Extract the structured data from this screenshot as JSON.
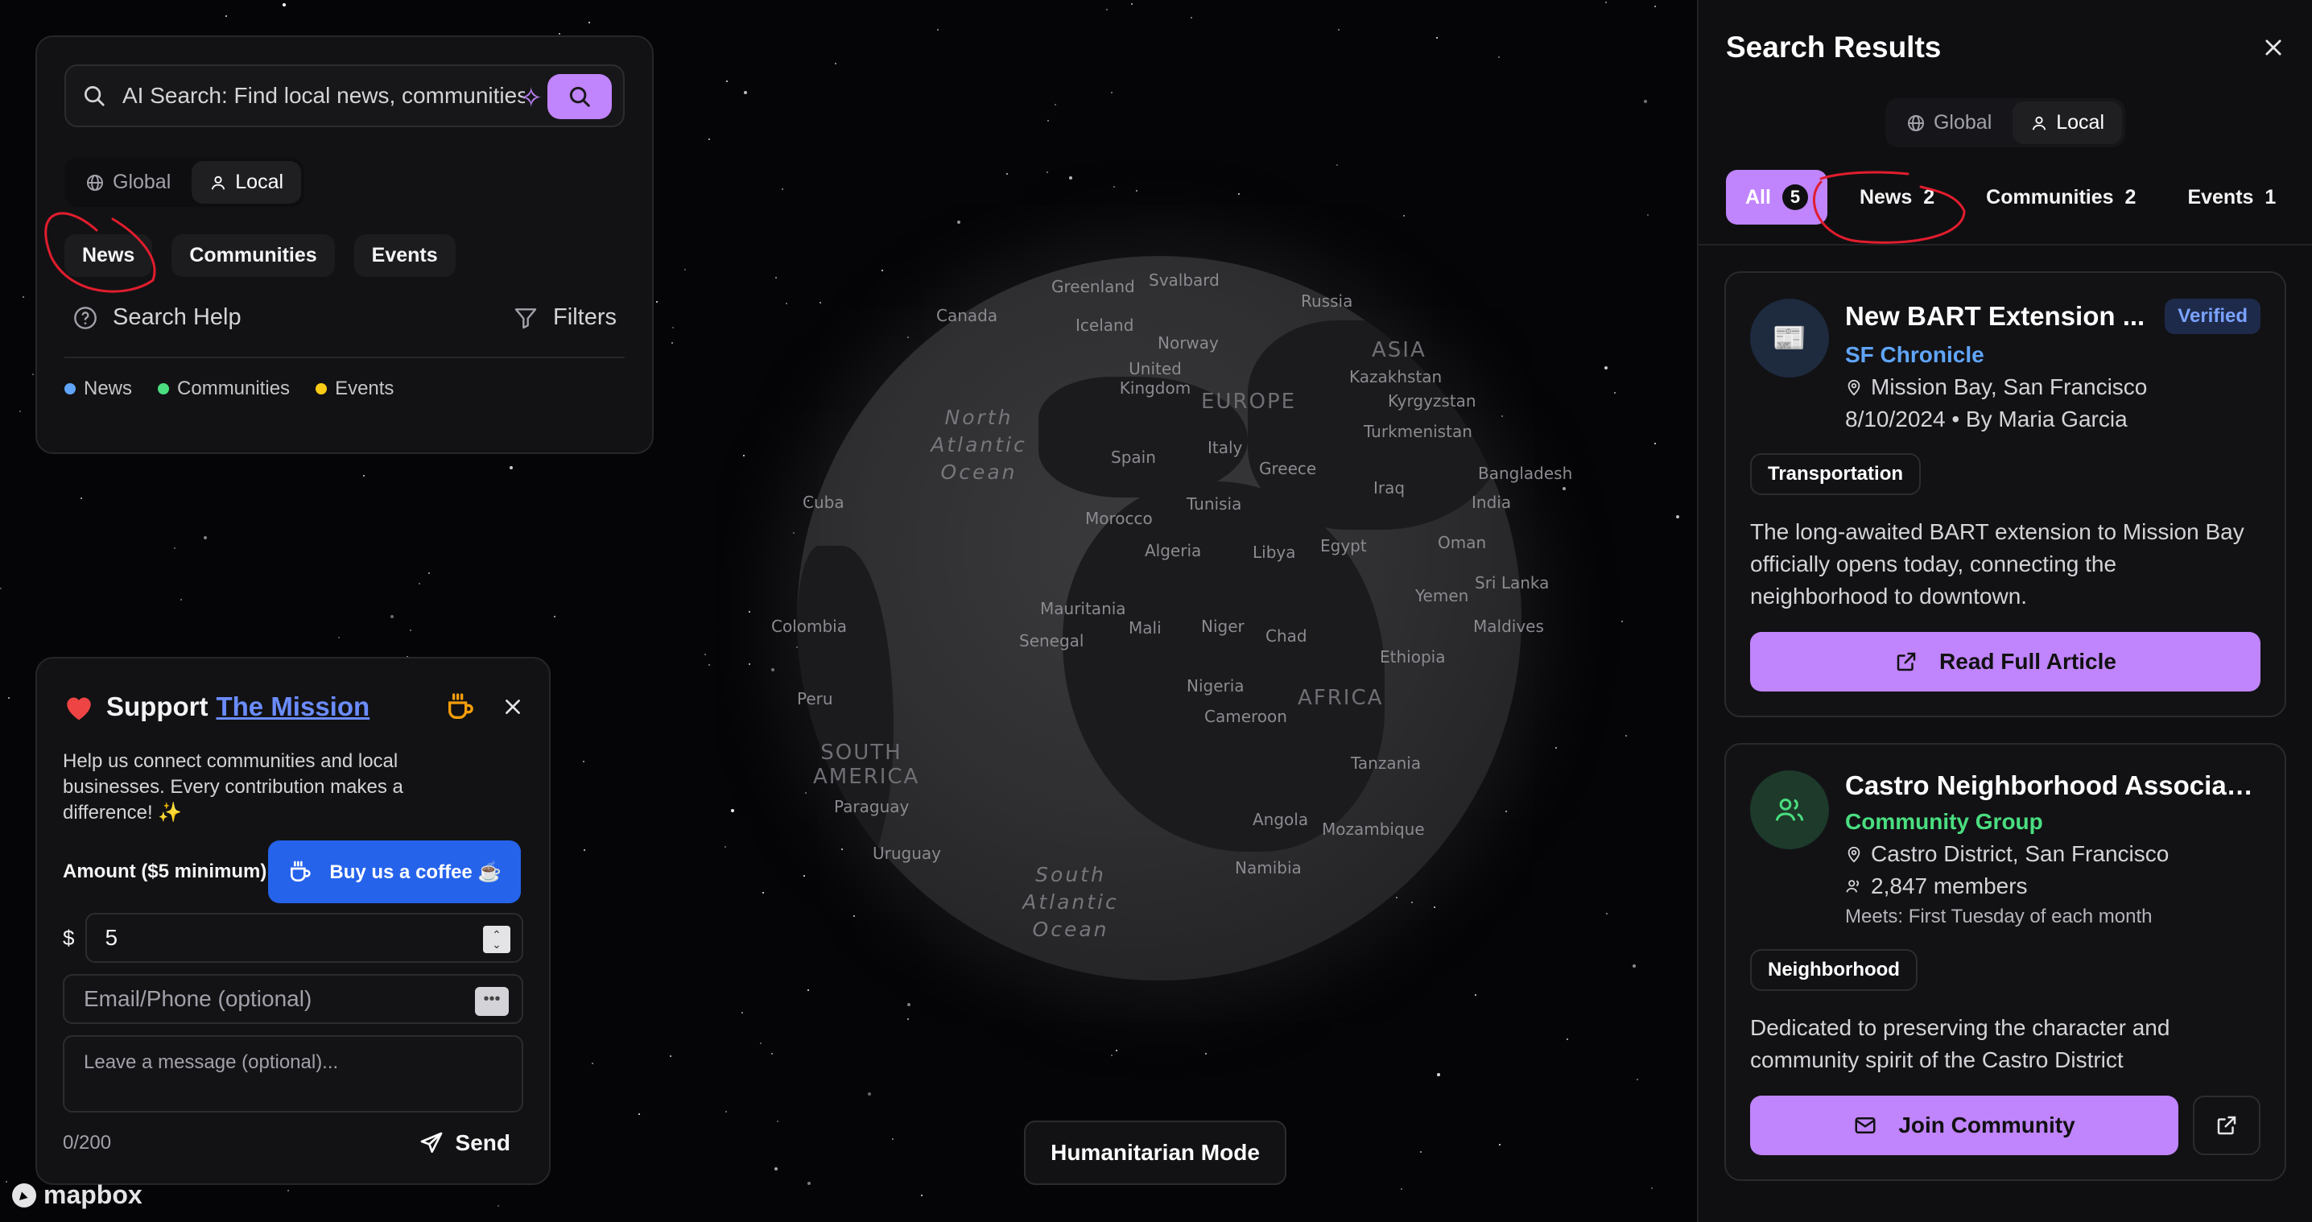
{
  "search": {
    "placeholder": "AI Search: Find local news, communities",
    "scope": {
      "global": "Global",
      "local": "Local"
    },
    "categories": [
      "News",
      "Communities",
      "Events"
    ],
    "help": "Search Help",
    "filters": "Filters",
    "legend": [
      {
        "label": "News",
        "color": "#60a5fa"
      },
      {
        "label": "Communities",
        "color": "#4ade80"
      },
      {
        "label": "Events",
        "color": "#facc15"
      }
    ]
  },
  "support": {
    "title": "Support",
    "link": "The Mission",
    "description": "Help us connect communities and local businesses. Every contribution makes a difference! ✨",
    "amount_label": "Amount ($5 minimum)",
    "coffee_button": "Buy us a coffee ☕",
    "currency": "$",
    "amount_value": "5",
    "contact_placeholder": "Email/Phone (optional)",
    "message_placeholder": "Leave a message (optional)...",
    "counter": "0/200",
    "send": "Send"
  },
  "map": {
    "mode_button": "Humanitarian Mode",
    "attribution": "mapbox",
    "labels": [
      "Greenland",
      "Svalbard",
      "Russia",
      "Canada",
      "Iceland",
      "Norway",
      "ASIA",
      "United Kingdom",
      "Kazakhstan",
      "EUROPE",
      "Kyrgyzstan",
      "North Atlantic Ocean",
      "Turkmenistan",
      "Spain",
      "Italy",
      "Greece",
      "Cuba",
      "Bangladesh",
      "Iraq",
      "India",
      "Morocco",
      "Tunisia",
      "Algeria",
      "Libya",
      "Egypt",
      "Oman",
      "Sri Lanka",
      "Yemen",
      "Mauritania",
      "Mali",
      "Niger",
      "Colombia",
      "Senegal",
      "Chad",
      "Maldives",
      "Ethiopia",
      "Nigeria",
      "AFRICA",
      "Peru",
      "Cameroon",
      "SOUTH AMERICA",
      "Tanzania",
      "Paraguay",
      "Angola",
      "Mozambique",
      "Uruguay",
      "Namibia",
      "South Atlantic Ocean"
    ]
  },
  "results": {
    "title": "Search Results",
    "scope": {
      "global": "Global",
      "local": "Local"
    },
    "tabs": [
      {
        "label": "All",
        "count": "5"
      },
      {
        "label": "News",
        "count": "2"
      },
      {
        "label": "Communities",
        "count": "2"
      },
      {
        "label": "Events",
        "count": "1"
      }
    ],
    "cards": [
      {
        "title": "New BART Extension ...",
        "badge": "Verified",
        "source": "SF Chronicle",
        "location": "Mission Bay, San Francisco",
        "date_author": "8/10/2024 • By Maria Garcia",
        "tag": "Transportation",
        "description": "The long-awaited BART extension to Mission Bay officially opens today, connecting the neighborhood to downtown.",
        "action": "Read Full Article"
      },
      {
        "title": "Castro Neighborhood Association",
        "source": "Community Group",
        "location": "Castro District, San Francisco",
        "members": "2,847 members",
        "schedule": "Meets: First Tuesday of each month",
        "tag": "Neighborhood",
        "description": "Dedicated to preserving the character and community spirit of the Castro District",
        "action": "Join Community"
      }
    ]
  },
  "colors": {
    "accent": "#c084fc",
    "blue": "#2563eb",
    "link": "#6b8cff"
  }
}
